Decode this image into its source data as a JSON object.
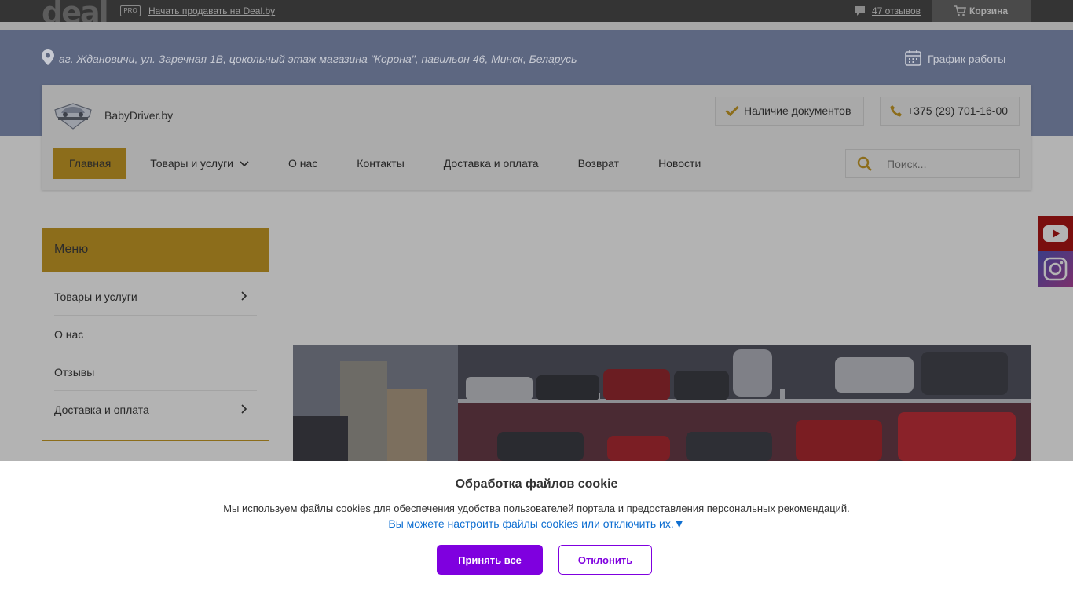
{
  "dealbar": {
    "logo": "deal",
    "pro_badge": "PRO",
    "sell_link": "Начать продавать на Deal.by",
    "reviews": "47 отзывов",
    "cart": "Корзина"
  },
  "header": {
    "address": "аг. Ждановичи, ул. Заречная 1В, цокольный этаж магазина \"Корона\", павильон 46, Минск, Беларусь",
    "schedule": "График работы",
    "brand_name": "BabyDriver.by",
    "docs_button": "Наличие документов",
    "phone": "+375 (29) 701-16-00"
  },
  "nav": {
    "items": [
      "Главная",
      "Товары и услуги",
      "О нас",
      "Контакты",
      "Доставка и оплата",
      "Возврат",
      "Новости"
    ],
    "active": "Главная"
  },
  "search": {
    "placeholder": "Поиск..."
  },
  "sidebar": {
    "title": "Меню",
    "items": [
      "Товары и услуги",
      "О нас",
      "Отзывы",
      "Доставка и оплата"
    ]
  },
  "social": {
    "icons": [
      "youtube-icon",
      "instagram-icon"
    ]
  },
  "cookie": {
    "title": "Обработка файлов cookie",
    "text": "Мы используем файлы cookies для обеспечения удобства пользователей портала и предоставления персональных рекомендаций.",
    "link": "Вы можете настроить файлы cookies или отключить их.▼",
    "accept": "Принять все",
    "decline": "Отклонить"
  },
  "colors": {
    "accent": "#e1ae2c",
    "cookie_button": "#7f00df",
    "link": "#0f6fd1"
  }
}
